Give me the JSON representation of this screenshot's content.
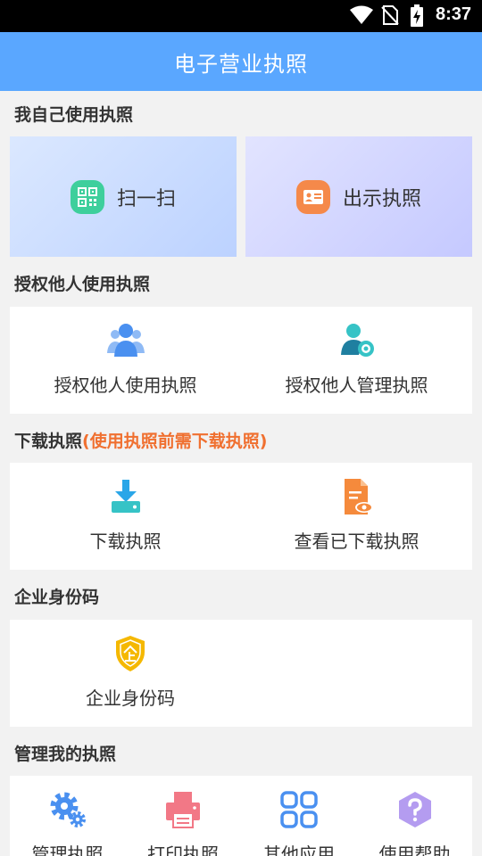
{
  "status_bar": {
    "time": "8:37"
  },
  "app_bar": {
    "title": "电子营业执照"
  },
  "sections": {
    "self": {
      "title": "我自己使用执照",
      "scan_label": "扫一扫",
      "show_label": "出示执照"
    },
    "authorize": {
      "title": "授权他人使用执照",
      "use_label": "授权他人使用执照",
      "manage_label": "授权他人管理执照"
    },
    "download": {
      "title": "下载执照",
      "note": "(使用执照前需下载执照)",
      "download_label": "下载执照",
      "view_label": "查看已下载执照"
    },
    "identity": {
      "title": "企业身份码",
      "code_label": "企业身份码"
    },
    "manage": {
      "title": "管理我的执照",
      "items": [
        {
          "label": "管理执照",
          "icon": "gear-icon"
        },
        {
          "label": "打印执照",
          "icon": "printer-icon"
        },
        {
          "label": "其他应用",
          "icon": "apps-icon"
        },
        {
          "label": "使用帮助",
          "icon": "help-icon"
        }
      ]
    }
  },
  "colors": {
    "app_bar": "#5aa7ff",
    "note": "#f07030",
    "scan_icon": "#3ecf9c",
    "show_icon": "#f5894a",
    "blue_icon": "#4a90f0",
    "teal_icon": "#36c3c6",
    "download_icon": "#2aa6e8",
    "orange_icon": "#f58a3c",
    "shield_icon": "#f5b800",
    "printer_icon": "#f27886",
    "help_icon": "#b49cf0"
  }
}
